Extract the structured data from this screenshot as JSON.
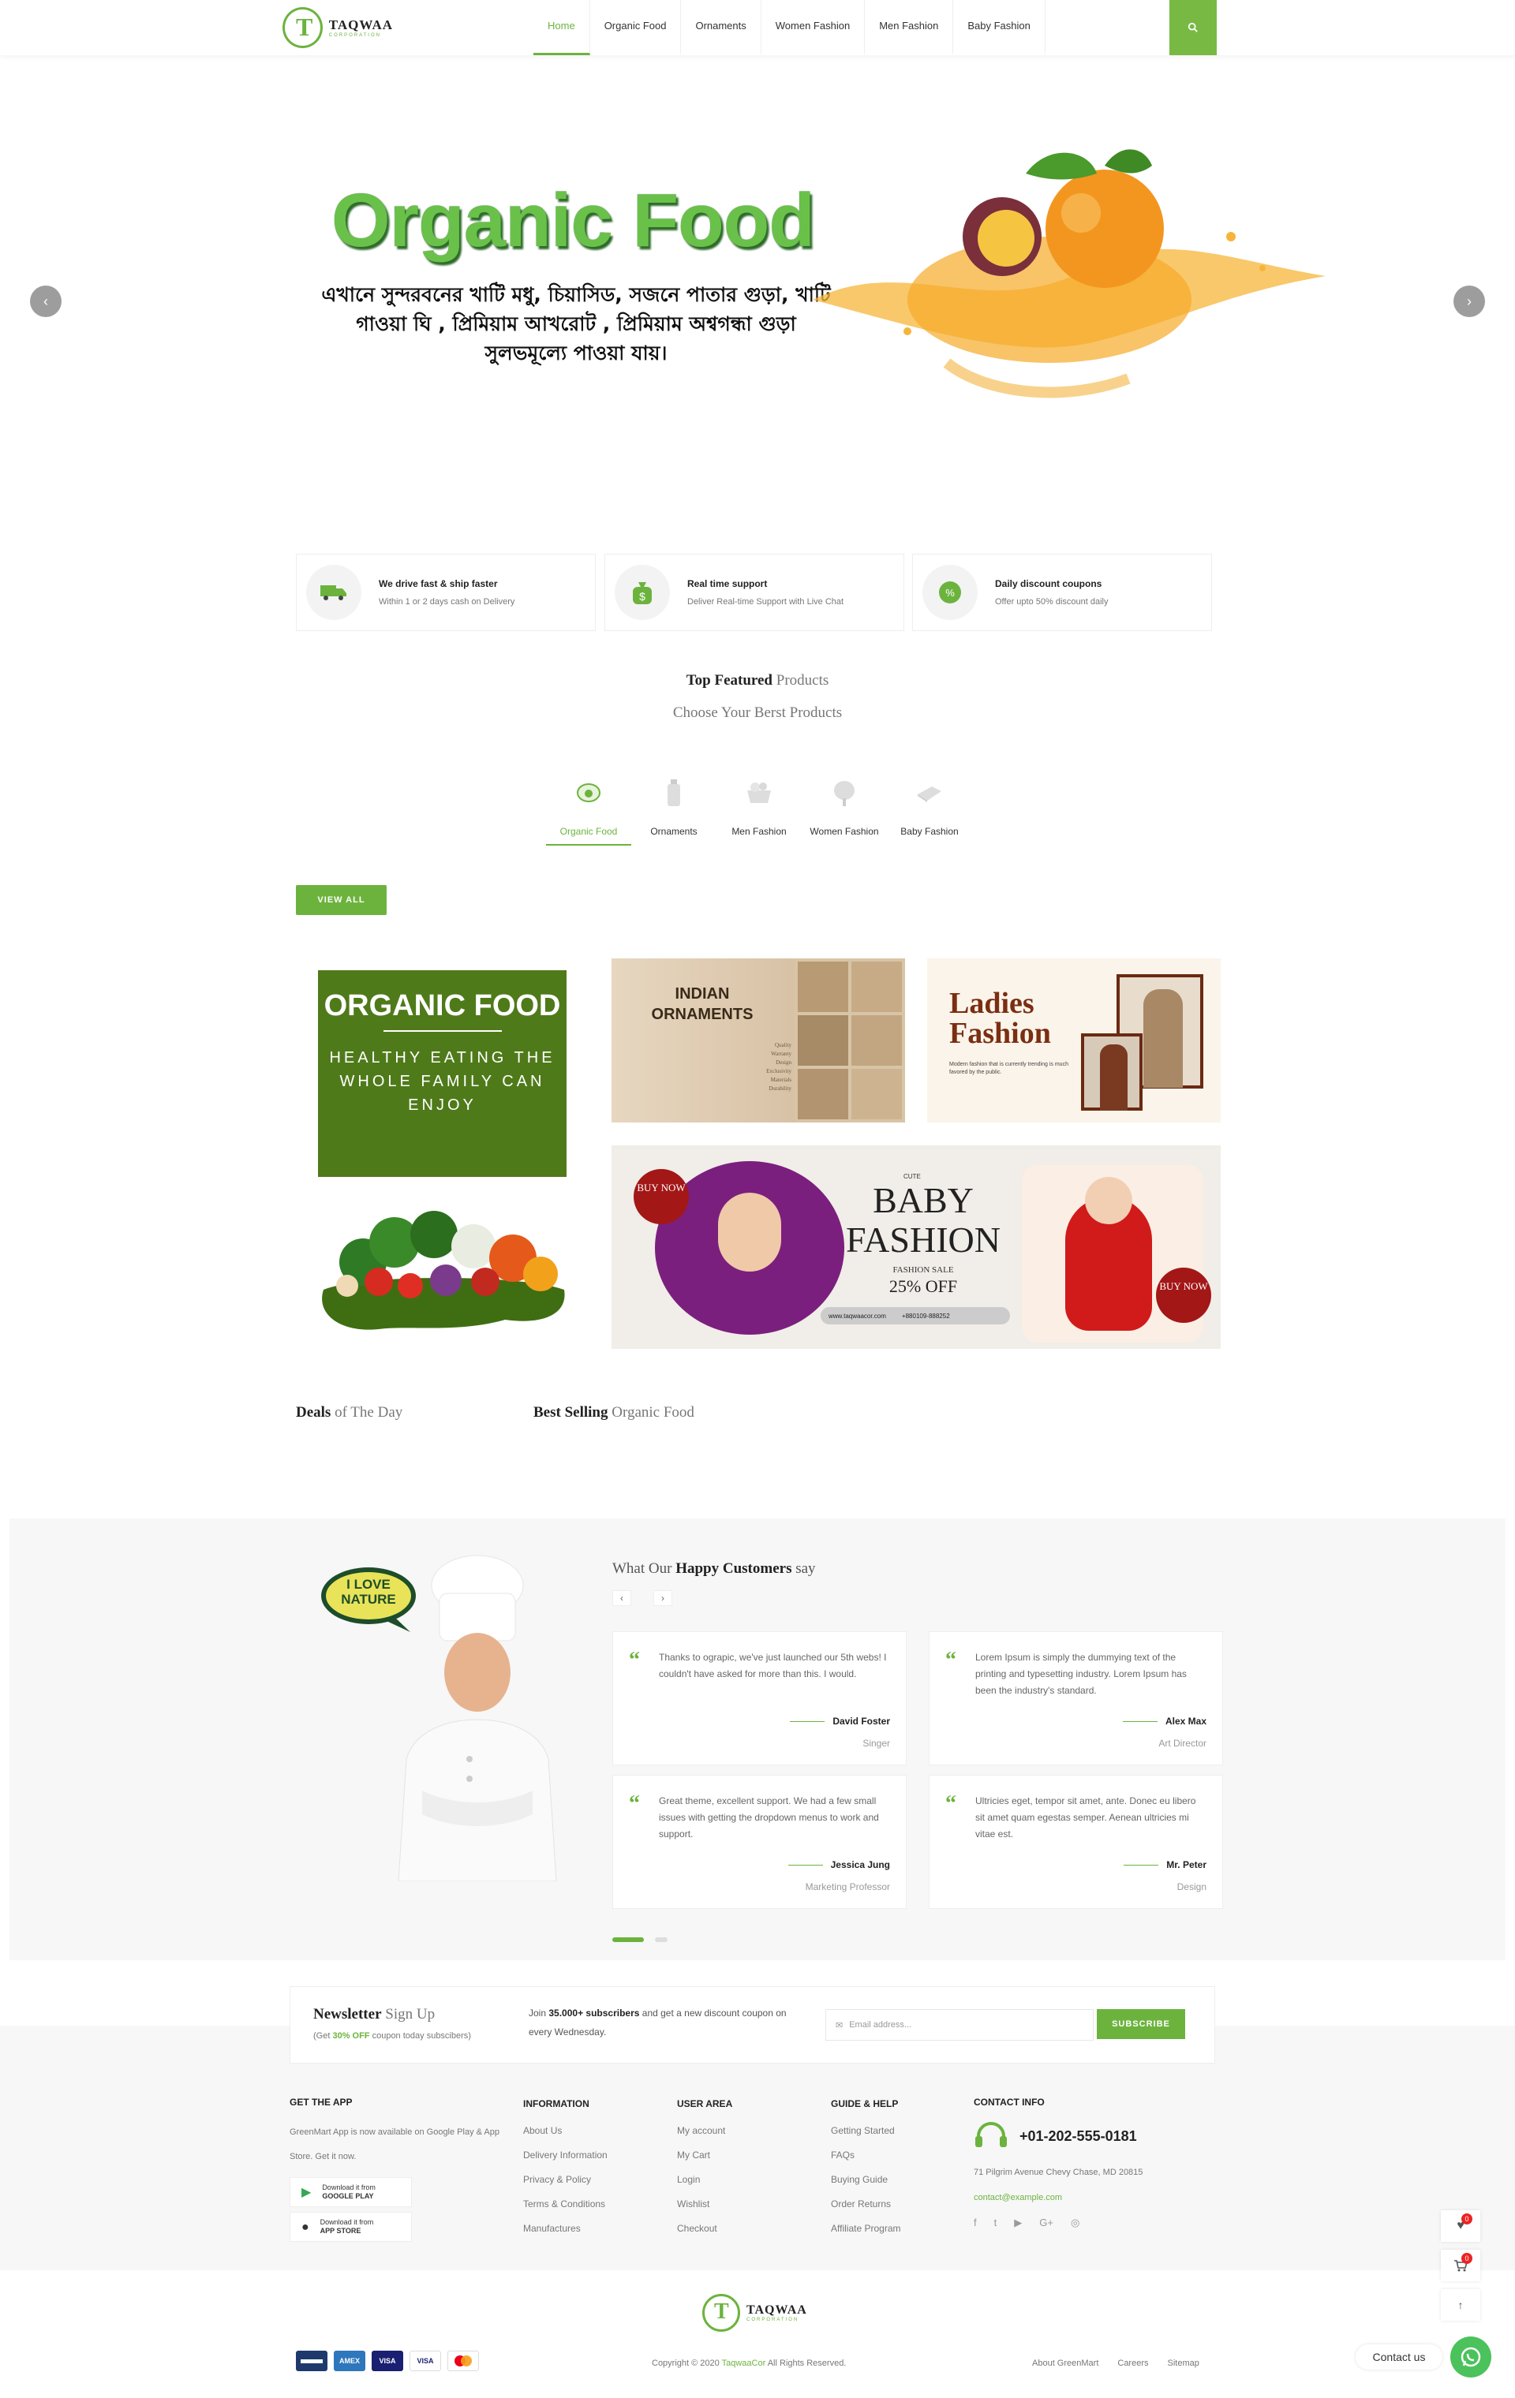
{
  "header": {
    "logo_name": "TAQWAA",
    "logo_sub": "CORPORATION",
    "nav": [
      "Home",
      "Organic Food",
      "Ornaments",
      "Women Fashion",
      "Men Fashion",
      "Baby Fashion"
    ],
    "active": "Home"
  },
  "hero": {
    "title": "Organic Food",
    "text": "এখানে সুন্দরবনের খাটি মধু, চিয়াসিড, সজনে পাতার গুড়া, খাটি গাওয়া ঘি , প্রিমিয়াম আখরোট , প্রিমিয়াম অশ্বগন্ধা গুড়া সুলভমূল্যে পাওয়া যায়।",
    "prev": "‹",
    "next": "›"
  },
  "features": [
    {
      "icon": "truck-icon",
      "title": "We drive fast & ship faster",
      "desc": "Within 1 or 2 days cash on Delivery"
    },
    {
      "icon": "money-bag-icon",
      "title": "Real time support",
      "desc": "Deliver Real-time Support with Live Chat"
    },
    {
      "icon": "discount-icon",
      "title": "Daily discount coupons",
      "desc": "Offer upto 50% discount daily"
    }
  ],
  "featured": {
    "title_bold": "Top Featured",
    "title_light": " Products",
    "subtitle": "Choose Your Berst Products",
    "tabs": [
      "Organic Food",
      "Ornaments",
      "Men Fashion",
      "Women Fashion",
      "Baby Fashion"
    ],
    "active_tab": "Organic Food",
    "view_all": "VIEW ALL"
  },
  "banners": {
    "organic_title": "ORGANIC FOOD",
    "organic_sub": "HEALTHY EATING THE WHOLE FAMILY CAN ENJOY",
    "ornaments_title": "INDIAN ORNAMENTS",
    "ornaments_list": [
      "Quality",
      "Warranty",
      "Design",
      "Exclusivity",
      "Materials",
      "Durability"
    ],
    "ladies_title": "Ladies Fashion",
    "ladies_text": "Modern fashion that is currently trending is much favored by the public.",
    "baby_cute": "CUTE",
    "baby_title": "BABY FASHION",
    "baby_sale": "FASHION SALE",
    "baby_off": "25% OFF",
    "baby_web": "www.taqwaacor.com",
    "baby_phone": "+880109-888252",
    "buy_now": "BUY NOW"
  },
  "deals": {
    "a_bold": "Deals",
    "a_light": " of The Day",
    "b_bold": "Best Selling",
    "b_light": " Organic Food"
  },
  "testimonials": {
    "badge_line1": "I LOVE",
    "badge_line2": "NATURE",
    "head_light": "What Our ",
    "head_bold": "Happy Customers",
    "head_tail": " say",
    "prev": "‹",
    "next": "›",
    "items": [
      {
        "text": "Thanks to ograpic, we've just launched our 5th webs! I couldn't have asked for more than this. I would.",
        "name": "David Foster",
        "role": "Singer"
      },
      {
        "text": "Lorem Ipsum is simply the dummying text of the printing and typesetting industry. Lorem Ipsum has been the industry's standard.",
        "name": "Alex Max",
        "role": "Art Director"
      },
      {
        "text": "Great theme, excellent support. We had a few small issues with getting the dropdown menus to work and support.",
        "name": "Jessica Jung",
        "role": "Marketing Professor"
      },
      {
        "text": "Ultricies eget, tempor sit amet, ante. Donec eu libero sit amet quam egestas semper. Aenean ultricies mi vitae est.",
        "name": "Mr. Peter",
        "role": "Design"
      }
    ]
  },
  "newsletter": {
    "title_bold": "Newsletter",
    "title_light": " Sign Up",
    "sub_pre": "(Get ",
    "sub_off": "30% OFF",
    "sub_post": " coupon today subscibers)",
    "join_pre": "Join ",
    "join_bold": "35.000+ subscribers",
    "join_post": " and get a new discount coupon on every Wednesday.",
    "placeholder": "Email address...",
    "button": "SUBSCRIBE"
  },
  "footer": {
    "app_head": "GET THE APP",
    "app_text": "GreenMart App is now available on Google Play & App Store. Get it now.",
    "google_small": "Download it from",
    "google_big": "GOOGLE PLAY",
    "apple_small": "Download it from",
    "apple_big": "APP STORE",
    "info_head": "INFORMATION",
    "info": [
      "About Us",
      "Delivery Information",
      "Privacy & Policy",
      "Terms & Conditions",
      "Manufactures"
    ],
    "user_head": "USER AREA",
    "user": [
      "My account",
      "My Cart",
      "Login",
      "Wishlist",
      "Checkout"
    ],
    "guide_head": "GUIDE & HELP",
    "guide": [
      "Getting Started",
      "FAQs",
      "Buying Guide",
      "Order Returns",
      "Affiliate Program"
    ],
    "contact_head": "CONTACT INFO",
    "phone": "+01-202-555-0181",
    "address": "71 Pilgrim Avenue Chevy Chase, MD 20815",
    "email": "contact@example.com",
    "socials": [
      "facebook-icon",
      "twitter-icon",
      "youtube-icon",
      "google-plus-icon",
      "instagram-icon"
    ]
  },
  "bottom": {
    "logo_name": "TAQWAA",
    "logo_sub": "CORPORATION",
    "copy_pre": "Copyright © 2020 ",
    "copy_brand": "TaqwaaCor",
    "copy_post": " All Rights Reserved.",
    "links": [
      "About GreenMart",
      "Careers",
      "Sitemap"
    ],
    "payments": [
      "card",
      "AMEX",
      "VISA",
      "VISA",
      "MC"
    ]
  },
  "side": {
    "wishlist_count": "0",
    "cart_count": "0",
    "contact": "Contact us"
  },
  "colors": {
    "accent": "#6cb33e",
    "organic_box": "#4f7a1a"
  }
}
